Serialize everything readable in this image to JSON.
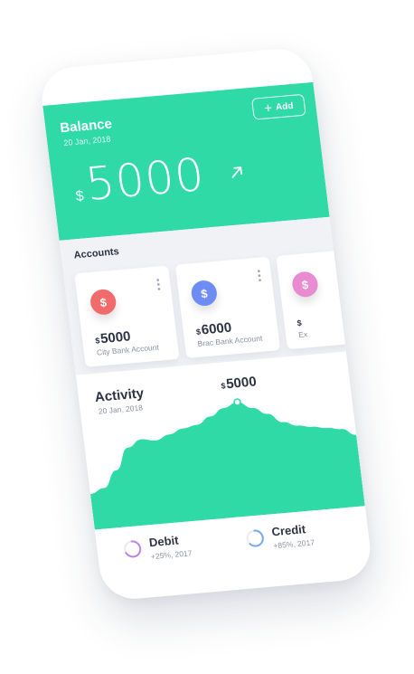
{
  "balance": {
    "title": "Balance",
    "date": "20 Jan, 2018",
    "currency": "$",
    "amount": "5000",
    "add_label": "Add",
    "color": "#2fdaa6"
  },
  "accounts": {
    "title": "Accounts",
    "items": [
      {
        "currency": "$",
        "amount": "5000",
        "name": "City Bank Account",
        "icon": "dollar-icon",
        "color": "#f16b6b"
      },
      {
        "currency": "$",
        "amount": "6000",
        "name": "Brac Bank Account",
        "icon": "dollar-icon",
        "color": "#6d8df5"
      },
      {
        "currency": "$",
        "amount": "",
        "name": "Ex",
        "icon": "dollar-icon",
        "color": "#e98bd0"
      }
    ]
  },
  "activity": {
    "title": "Activity",
    "date": "20 Jan, 2018",
    "currency": "$",
    "value": "5000",
    "legend": [
      {
        "label": "Debit",
        "sub": "+25%, 2017",
        "color": "#c084e8"
      },
      {
        "label": "Credit",
        "sub": "+85%, 2017",
        "color": "#7aa8ef"
      }
    ]
  },
  "chart_data": {
    "type": "area",
    "title": "Activity",
    "series": [
      {
        "values": [
          30,
          34,
          48,
          66,
          72,
          70,
          74,
          78,
          80,
          86,
          92,
          96,
          90,
          84,
          76,
          72,
          70,
          68,
          66,
          60
        ]
      }
    ],
    "ylim": [
      0,
      100
    ],
    "highlight": {
      "index": 11,
      "label": "$5000"
    },
    "grid": false,
    "fill_color": "#2fdaa6"
  }
}
